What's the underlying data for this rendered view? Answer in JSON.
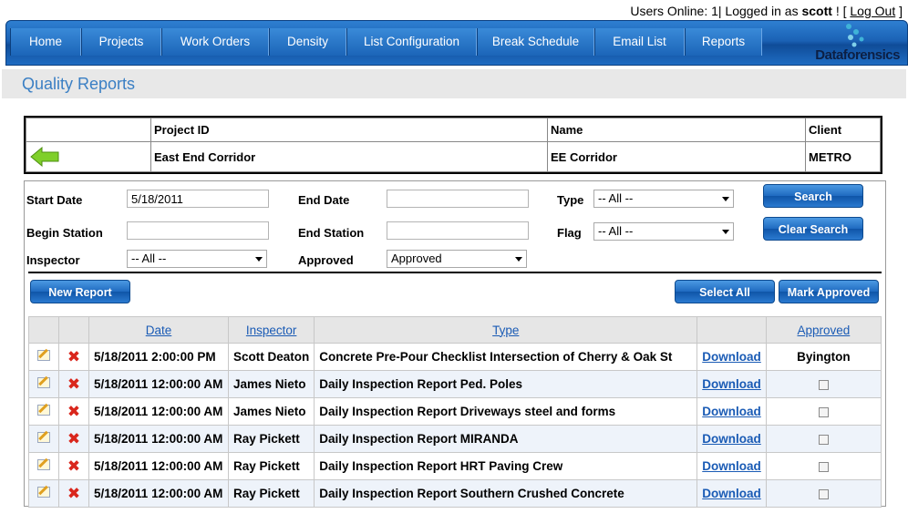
{
  "status": {
    "users_online_text": "Users Online: 1| Logged in as",
    "username": "scott",
    "suffix_text": "! [",
    "logout_label": "Log Out",
    "close_bracket": "]"
  },
  "nav": {
    "items": [
      {
        "label": "Home"
      },
      {
        "label": "Projects"
      },
      {
        "label": "Work Orders"
      },
      {
        "label": "Density"
      },
      {
        "label": "List Configuration"
      },
      {
        "label": "Break Schedule"
      },
      {
        "label": "Email List"
      },
      {
        "label": "Reports"
      }
    ],
    "logo_text": "Dataforensics"
  },
  "page": {
    "title": "Quality Reports"
  },
  "project": {
    "headers": {
      "project_id": "Project ID",
      "name": "Name",
      "client": "Client"
    },
    "values": {
      "project_id": "East End Corridor",
      "name": "EE Corridor",
      "client": "METRO"
    },
    "back_icon": "green-left-arrow-icon"
  },
  "search": {
    "start_date_label": "Start Date",
    "start_date_value": "5/18/2011",
    "end_date_label": "End Date",
    "end_date_value": "",
    "type_label": "Type",
    "type_value": "-- All --",
    "begin_station_label": "Begin Station",
    "begin_station_value": "",
    "end_station_label": "End Station",
    "end_station_value": "",
    "flag_label": "Flag",
    "flag_value": "-- All --",
    "inspector_label": "Inspector",
    "inspector_value": "-- All --",
    "approved_label": "Approved",
    "approved_value": "Approved",
    "search_button": "Search",
    "clear_button": "Clear Search"
  },
  "actions": {
    "new_report": "New Report",
    "select_all": "Select All",
    "mark_approved": "Mark Approved"
  },
  "grid": {
    "headers": {
      "date": "Date",
      "inspector": "Inspector",
      "type": "Type",
      "approved": "Approved"
    },
    "rows": [
      {
        "date": "5/18/2011 2:00:00 PM",
        "inspector": "Scott Deaton",
        "type": "Concrete Pre-Pour Checklist Intersection of Cherry & Oak St",
        "download": "Download",
        "approved": "Byington"
      },
      {
        "date": "5/18/2011 12:00:00 AM",
        "inspector": "James Nieto",
        "type": "Daily Inspection Report Ped. Poles",
        "download": "Download",
        "approved": ""
      },
      {
        "date": "5/18/2011 12:00:00 AM",
        "inspector": "James Nieto",
        "type": "Daily Inspection Report Driveways steel and forms",
        "download": "Download",
        "approved": ""
      },
      {
        "date": "5/18/2011 12:00:00 AM",
        "inspector": "Ray Pickett",
        "type": "Daily Inspection Report MIRANDA",
        "download": "Download",
        "approved": ""
      },
      {
        "date": "5/18/2011 12:00:00 AM",
        "inspector": "Ray Pickett",
        "type": "Daily Inspection Report HRT Paving Crew",
        "download": "Download",
        "approved": ""
      },
      {
        "date": "5/18/2011 12:00:00 AM",
        "inspector": "Ray Pickett",
        "type": "Daily Inspection Report Southern Crushed Concrete",
        "download": "Download",
        "approved": ""
      }
    ],
    "colors": {
      "link": "#1a5bb5",
      "delete": "#d9261c",
      "alt_row": "#eef3fa"
    }
  }
}
